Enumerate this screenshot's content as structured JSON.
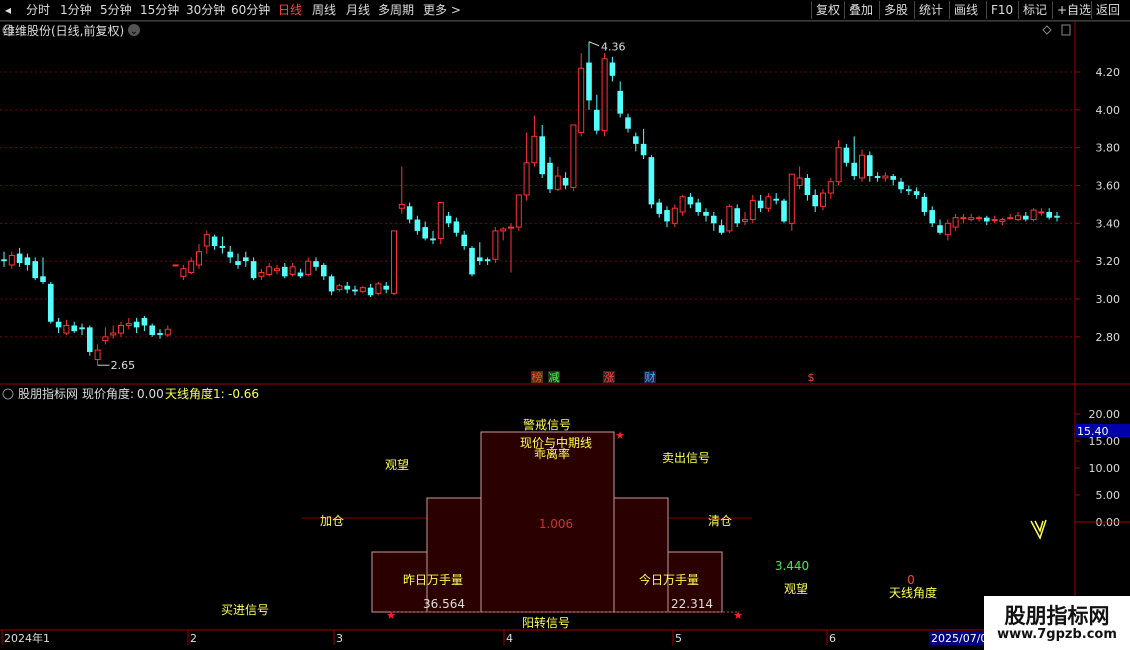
{
  "toolbar": {
    "periods": [
      "分时",
      "1分钟",
      "5分钟",
      "15分钟",
      "30分钟",
      "60分钟",
      "日线",
      "周线",
      "月线",
      "多周期",
      "更多"
    ],
    "active_index": 6,
    "right_buttons": [
      "复权",
      "叠加",
      "多股",
      "统计",
      "画线",
      "F10",
      "标记",
      "+自选",
      "返回"
    ]
  },
  "price_panel": {
    "title": "维维股份(日线,前复权)",
    "y_ticks": [
      "4.20",
      "4.00",
      "3.80",
      "3.60",
      "3.40",
      "3.20",
      "3.00",
      "2.80"
    ],
    "high_label": "4.36",
    "low_label": "2.65",
    "event_markers": [
      "榜",
      "减",
      "涨",
      "财",
      "$"
    ]
  },
  "indicator_panel": {
    "title_name": "股朋指标网",
    "title_item1_label": "现价角度:",
    "title_item1_value": "0.00",
    "title_item2_label": "天线角度1:",
    "title_item2_value": "-0.66",
    "y_ticks": [
      "20.00",
      "15.00",
      "10.00",
      "5.00",
      "0.00"
    ],
    "current_value": "15.40",
    "labels": {
      "warning": "警戒信号",
      "deviation_line1": "现价与中期线",
      "deviation_line2": "乖离率",
      "watch_left": "观望",
      "sell_signal": "卖出信号",
      "add_position": "加仓",
      "clear_position": "清仓",
      "center_value": "1.006",
      "yesterday_volume": "昨日万手量",
      "yesterday_value": "36.564",
      "today_volume": "今日万手量",
      "today_value": "22.314",
      "buy_signal": "买进信号",
      "bounce_signal": "阳转信号",
      "green_value": "3.440",
      "watch_right": "观望",
      "zero_value": "0",
      "antenna_angle": "天线角度"
    }
  },
  "time_axis": {
    "labels": [
      "2024年1",
      "2",
      "3",
      "4",
      "5",
      "6"
    ],
    "end_label": "2025/07/0"
  },
  "watermark": {
    "title": "股朋指标网",
    "url": "www.7gpzb.com"
  },
  "colors": {
    "up": "#ff3232",
    "down": "#54ffff",
    "grid": "#7a0000",
    "axis_text": "#dddddd",
    "yellow": "#ffff55",
    "bar_fill": "#2a0000",
    "highlight_label": "#0000aa"
  },
  "chart_data": {
    "type": "candlestick",
    "ohlc": [
      [
        3.21,
        3.2,
        3.25,
        3.17
      ],
      [
        3.18,
        3.23,
        3.25,
        3.16
      ],
      [
        3.24,
        3.19,
        3.27,
        3.17
      ],
      [
        3.22,
        3.18,
        3.24,
        3.15
      ],
      [
        3.2,
        3.11,
        3.22,
        3.1
      ],
      [
        3.12,
        3.09,
        3.22,
        3.08
      ],
      [
        3.08,
        2.88,
        3.09,
        2.87
      ],
      [
        2.88,
        2.85,
        2.9,
        2.82
      ],
      [
        2.82,
        2.86,
        2.89,
        2.81
      ],
      [
        2.86,
        2.83,
        2.88,
        2.82
      ],
      [
        2.85,
        2.84,
        2.87,
        2.81
      ],
      [
        2.85,
        2.72,
        2.86,
        2.7
      ],
      [
        2.68,
        2.73,
        2.76,
        2.65
      ],
      [
        2.78,
        2.8,
        2.85,
        2.76
      ],
      [
        2.81,
        2.82,
        2.86,
        2.79
      ],
      [
        2.82,
        2.86,
        2.88,
        2.8
      ],
      [
        2.86,
        2.87,
        2.9,
        2.84
      ],
      [
        2.88,
        2.85,
        2.9,
        2.82
      ],
      [
        2.9,
        2.86,
        2.91,
        2.83
      ],
      [
        2.86,
        2.81,
        2.87,
        2.8
      ],
      [
        2.82,
        2.81,
        2.84,
        2.79
      ],
      [
        2.81,
        2.84,
        2.86,
        2.8
      ],
      [
        3.18,
        3.18,
        3.18,
        3.18
      ],
      [
        3.12,
        3.16,
        3.18,
        3.1
      ],
      [
        3.14,
        3.2,
        3.22,
        3.13
      ],
      [
        3.18,
        3.25,
        3.29,
        3.16
      ],
      [
        3.28,
        3.34,
        3.36,
        3.24
      ],
      [
        3.33,
        3.28,
        3.34,
        3.26
      ],
      [
        3.28,
        3.27,
        3.33,
        3.24
      ],
      [
        3.25,
        3.22,
        3.28,
        3.19
      ],
      [
        3.2,
        3.18,
        3.24,
        3.16
      ],
      [
        3.22,
        3.2,
        3.25,
        3.17
      ],
      [
        3.2,
        3.11,
        3.22,
        3.1
      ],
      [
        3.12,
        3.14,
        3.16,
        3.1
      ],
      [
        3.13,
        3.17,
        3.19,
        3.12
      ],
      [
        3.15,
        3.16,
        3.18,
        3.13
      ],
      [
        3.17,
        3.12,
        3.19,
        3.11
      ],
      [
        3.13,
        3.17,
        3.19,
        3.12
      ],
      [
        3.14,
        3.12,
        3.16,
        3.11
      ],
      [
        3.13,
        3.2,
        3.22,
        3.12
      ],
      [
        3.2,
        3.17,
        3.22,
        3.15
      ],
      [
        3.18,
        3.12,
        3.19,
        3.1
      ],
      [
        3.12,
        3.04,
        3.13,
        3.02
      ],
      [
        3.05,
        3.07,
        3.08,
        3.04
      ],
      [
        3.07,
        3.05,
        3.09,
        3.03
      ],
      [
        3.05,
        3.04,
        3.07,
        3.02
      ],
      [
        3.04,
        3.06,
        3.07,
        3.03
      ],
      [
        3.06,
        3.02,
        3.08,
        3.01
      ],
      [
        3.03,
        3.08,
        3.09,
        3.02
      ],
      [
        3.07,
        3.05,
        3.09,
        3.03
      ],
      [
        3.03,
        3.36,
        3.36,
        3.02
      ],
      [
        3.48,
        3.5,
        3.7,
        3.45
      ],
      [
        3.49,
        3.42,
        3.51,
        3.4
      ],
      [
        3.42,
        3.36,
        3.44,
        3.34
      ],
      [
        3.38,
        3.32,
        3.41,
        3.31
      ],
      [
        3.32,
        3.31,
        3.36,
        3.29
      ],
      [
        3.32,
        3.51,
        3.51,
        3.29
      ],
      [
        3.44,
        3.4,
        3.46,
        3.38
      ],
      [
        3.41,
        3.35,
        3.43,
        3.33
      ],
      [
        3.34,
        3.28,
        3.36,
        3.26
      ],
      [
        3.27,
        3.13,
        3.28,
        3.12
      ],
      [
        3.22,
        3.2,
        3.3,
        3.18
      ],
      [
        3.21,
        3.2,
        3.22,
        3.18
      ],
      [
        3.21,
        3.36,
        3.38,
        3.19
      ],
      [
        3.36,
        3.37,
        3.38,
        3.31
      ],
      [
        3.38,
        3.38,
        3.4,
        3.14
      ],
      [
        3.38,
        3.55,
        3.55,
        3.36
      ],
      [
        3.55,
        3.72,
        3.88,
        3.52
      ],
      [
        3.72,
        3.86,
        3.97,
        3.7
      ],
      [
        3.86,
        3.66,
        3.92,
        3.64
      ],
      [
        3.72,
        3.58,
        3.75,
        3.56
      ],
      [
        3.58,
        3.65,
        3.7,
        3.57
      ],
      [
        3.64,
        3.6,
        3.67,
        3.58
      ],
      [
        3.59,
        3.92,
        3.92,
        3.57
      ],
      [
        3.88,
        4.22,
        4.3,
        3.86
      ],
      [
        4.25,
        4.05,
        4.36,
        4.0
      ],
      [
        4.0,
        3.89,
        4.08,
        3.87
      ],
      [
        3.89,
        4.27,
        4.3,
        3.86
      ],
      [
        4.25,
        4.18,
        4.28,
        4.15
      ],
      [
        4.1,
        3.98,
        4.15,
        3.96
      ],
      [
        3.96,
        3.9,
        3.98,
        3.88
      ],
      [
        3.86,
        3.82,
        3.88,
        3.78
      ],
      [
        3.82,
        3.76,
        3.9,
        3.74
      ],
      [
        3.75,
        3.5,
        3.76,
        3.48
      ],
      [
        3.51,
        3.45,
        3.53,
        3.43
      ],
      [
        3.47,
        3.41,
        3.49,
        3.38
      ],
      [
        3.4,
        3.48,
        3.5,
        3.38
      ],
      [
        3.46,
        3.54,
        3.55,
        3.44
      ],
      [
        3.54,
        3.5,
        3.56,
        3.48
      ],
      [
        3.51,
        3.46,
        3.53,
        3.44
      ],
      [
        3.46,
        3.44,
        3.48,
        3.41
      ],
      [
        3.44,
        3.4,
        3.46,
        3.36
      ],
      [
        3.39,
        3.35,
        3.42,
        3.34
      ],
      [
        3.36,
        3.49,
        3.5,
        3.35
      ],
      [
        3.48,
        3.4,
        3.5,
        3.38
      ],
      [
        3.41,
        3.42,
        3.46,
        3.39
      ],
      [
        3.42,
        3.52,
        3.55,
        3.4
      ],
      [
        3.52,
        3.48,
        3.55,
        3.46
      ],
      [
        3.48,
        3.54,
        3.56,
        3.46
      ],
      [
        3.53,
        3.52,
        3.56,
        3.5
      ],
      [
        3.52,
        3.41,
        3.53,
        3.4
      ],
      [
        3.4,
        3.66,
        3.66,
        3.36
      ],
      [
        3.6,
        3.64,
        3.7,
        3.58
      ],
      [
        3.64,
        3.55,
        3.66,
        3.52
      ],
      [
        3.55,
        3.49,
        3.58,
        3.46
      ],
      [
        3.49,
        3.56,
        3.58,
        3.47
      ],
      [
        3.56,
        3.62,
        3.64,
        3.53
      ],
      [
        3.62,
        3.8,
        3.84,
        3.6
      ],
      [
        3.8,
        3.72,
        3.82,
        3.7
      ],
      [
        3.72,
        3.65,
        3.86,
        3.63
      ],
      [
        3.64,
        3.76,
        3.79,
        3.62
      ],
      [
        3.76,
        3.65,
        3.78,
        3.62
      ],
      [
        3.65,
        3.64,
        3.67,
        3.62
      ],
      [
        3.64,
        3.65,
        3.67,
        3.62
      ],
      [
        3.65,
        3.63,
        3.66,
        3.6
      ],
      [
        3.62,
        3.58,
        3.64,
        3.56
      ],
      [
        3.58,
        3.57,
        3.6,
        3.55
      ],
      [
        3.57,
        3.55,
        3.59,
        3.53
      ],
      [
        3.54,
        3.46,
        3.56,
        3.44
      ],
      [
        3.47,
        3.4,
        3.49,
        3.38
      ],
      [
        3.39,
        3.35,
        3.42,
        3.34
      ],
      [
        3.34,
        3.4,
        3.42,
        3.31
      ],
      [
        3.38,
        3.43,
        3.45,
        3.36
      ],
      [
        3.43,
        3.43,
        3.45,
        3.4
      ],
      [
        3.42,
        3.43,
        3.45,
        3.41
      ],
      [
        3.43,
        3.43,
        3.44,
        3.41
      ],
      [
        3.43,
        3.41,
        3.44,
        3.39
      ],
      [
        3.42,
        3.42,
        3.44,
        3.4
      ],
      [
        3.41,
        3.42,
        3.43,
        3.39
      ],
      [
        3.43,
        3.43,
        3.45,
        3.42
      ],
      [
        3.42,
        3.44,
        3.46,
        3.41
      ],
      [
        3.44,
        3.42,
        3.46,
        3.41
      ],
      [
        3.42,
        3.47,
        3.48,
        3.41
      ],
      [
        3.46,
        3.46,
        3.48,
        3.44
      ],
      [
        3.46,
        3.43,
        3.48,
        3.42
      ],
      [
        3.44,
        3.43,
        3.46,
        3.41
      ]
    ],
    "ylim": [
      2.7,
      4.4
    ],
    "indicator_ylim": [
      -7,
      22
    ],
    "indicator_bars": [
      {
        "label": "昨日万手量",
        "from": -7,
        "to": -0.8
      },
      {
        "label": "",
        "from": -7,
        "to": 4.7
      },
      {
        "label": "现价与中期线乖离率",
        "from": -7,
        "to": 17
      },
      {
        "label": "",
        "from": -7,
        "to": 4.7
      },
      {
        "label": "今日万手量",
        "from": -7,
        "to": -0.8
      }
    ]
  }
}
